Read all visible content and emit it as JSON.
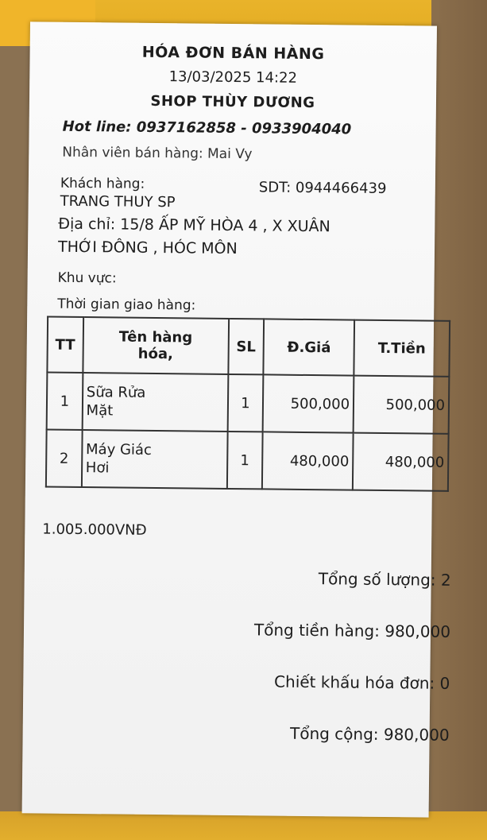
{
  "receipt": {
    "title": "HÓA ĐƠN BÁN HÀNG",
    "datetime": "13/03/2025 14:22",
    "shop_name": "SHOP THÙY DƯƠNG",
    "hotline": "Hot line: 0937162858 - 0933904040",
    "staff": "Nhân viên bán hàng: Mai Vy",
    "customer_label": "Khách hàng:",
    "customer_name": "TRANG THUY SP",
    "customer_phone": "SDT: 0944466439",
    "address_line1": "Địa chỉ: 15/8 ẤP MỸ HÒA 4 , X XUÂN",
    "address_line2": "THỚI ĐÔNG , HÓC MÔN",
    "area_label": "Khu vực:",
    "delivery_label": "Thời gian giao hàng:"
  },
  "table": {
    "headers": {
      "tt": "TT",
      "name_line1": "Tên hàng",
      "name_line2": "hóa,",
      "qty": "SL",
      "price": "Đ.Giá",
      "total": "T.Tiền"
    },
    "rows": [
      {
        "tt": "1",
        "name_line1": "Sữa Rửa",
        "name_line2": "Mặt",
        "qty": "1",
        "price": "500,000",
        "total": "500,000"
      },
      {
        "tt": "2",
        "name_line1": "Máy Giác",
        "name_line2": "Hơi",
        "qty": "1",
        "price": "480,000",
        "total": "480,000"
      }
    ]
  },
  "handwritten_note": "1.005.000VNĐ",
  "summary": {
    "total_qty": "Tổng số lượng: 2",
    "subtotal": "Tổng tiền hàng: 980,000",
    "discount": "Chiết khấu hóa đơn: 0",
    "grand_total": "Tổng cộng: 980,000"
  },
  "colors": {
    "background_tape": "#e9b32a",
    "background_cardboard": "#8a7152",
    "paper": "#f7f7f7",
    "ink": "#1d1d1d"
  }
}
